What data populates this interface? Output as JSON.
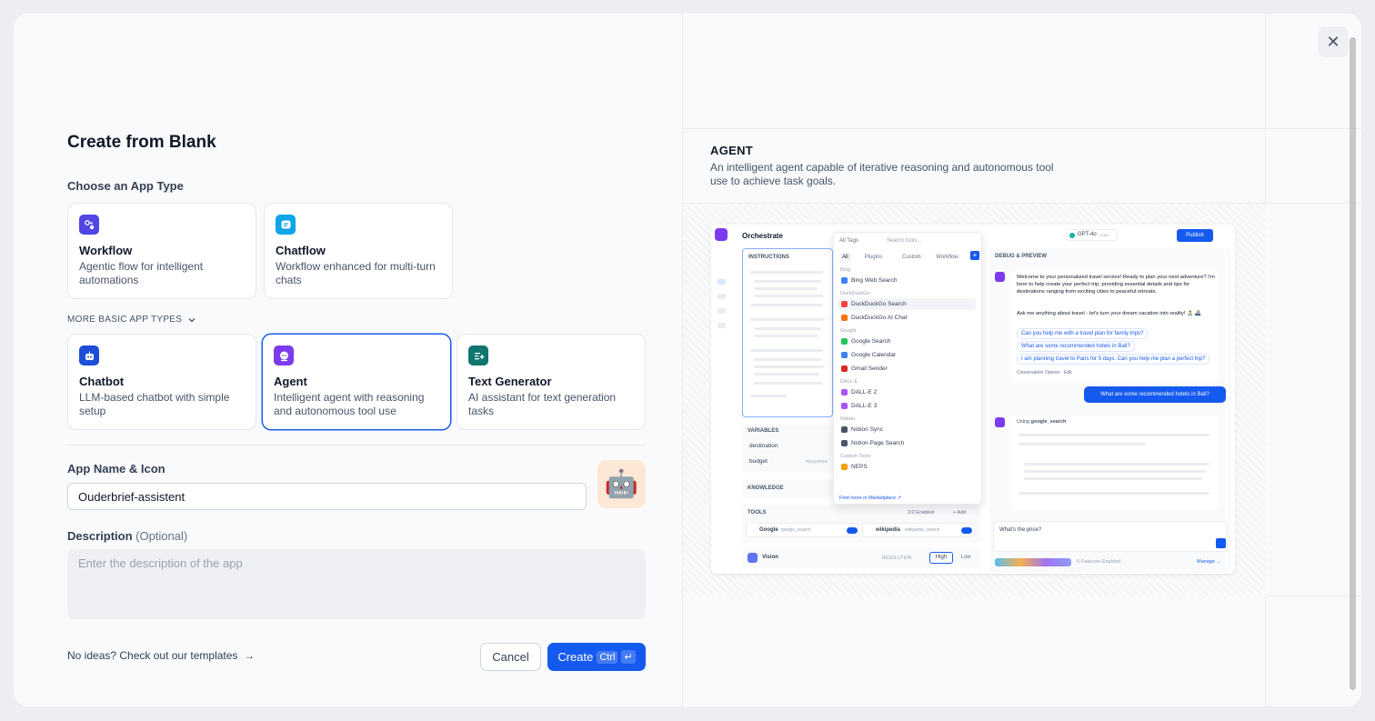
{
  "page": {
    "title": "Create from Blank",
    "choose_label": "Choose an App Type",
    "more_label": "MORE BASIC APP TYPES",
    "primary_types": [
      {
        "title": "Workflow",
        "desc": "Agentic flow for intelligent automations",
        "color": "#4f46e5"
      },
      {
        "title": "Chatflow",
        "desc": "Workflow enhanced for multi-turn chats",
        "color": "#0ea5e9"
      }
    ],
    "basic_types": [
      {
        "title": "Chatbot",
        "desc": "LLM-based chatbot with simple setup",
        "color": "#1d4ed8"
      },
      {
        "title": "Agent",
        "desc": "Intelligent agent with reasoning and autonomous tool use",
        "color": "#7c3aed"
      },
      {
        "title": "Text Generator",
        "desc": "AI assistant for text generation tasks",
        "color": "#0f766e"
      }
    ],
    "selected_type": "Agent",
    "name_label": "App Name & Icon",
    "name_value": "Ouderbrief-assistent",
    "avatar_emoji": "🤖",
    "desc_label": "Description",
    "desc_optional": "(Optional)",
    "desc_placeholder": "Enter the description of the app",
    "templates_link": "No ideas? Check out our templates",
    "cancel_label": "Cancel",
    "create_label": "Create",
    "create_kbd1": "Ctrl",
    "create_kbd2": "↵"
  },
  "preview": {
    "heading": "AGENT",
    "description": "An intelligent agent capable of iterative reasoning and autonomous tool use to achieve task goals.",
    "orchestrate": "Orchestrate",
    "instructions": "INSTRUCTIONS",
    "all_tags": "All Tags",
    "search_tools": "Search tools...",
    "tabs": [
      "All",
      "Plugins",
      "Custom",
      "Workflow"
    ],
    "tool_groups": [
      {
        "group": "Bing",
        "items": [
          "Bing Web Search"
        ]
      },
      {
        "group": "DuckDuckGo",
        "items": [
          "DuckDuckGo Search",
          "DuckDuckGo AI Chat"
        ]
      },
      {
        "group": "Google",
        "items": [
          "Google Search",
          "Google Calendar",
          "Gmail Sender"
        ]
      },
      {
        "group": "DALL-E",
        "items": [
          "DALL-E 2",
          "DALL-E 3"
        ]
      },
      {
        "group": "Notion",
        "items": [
          "Notion Sync",
          "Notion Page Search"
        ]
      },
      {
        "group": "Custom Tools",
        "items": [
          "NEPS"
        ]
      }
    ],
    "find_more": "Find more in Marketplace ↗",
    "variables": "VARIABLES",
    "var1": "destination",
    "var2": "budget",
    "required": "REQUIRED",
    "knowledge": "KNOWLEDGE",
    "tools": "TOOLS",
    "tools_enabled": "2/2 Enabled",
    "add": "+ Add",
    "tool1_name": "Google",
    "tool1_id": "google_search",
    "tool2_name": "wikipedia",
    "tool2_id": "wikipedia_search",
    "vision": "Vision",
    "resolution": "RESOLUTION",
    "high": "High",
    "low": "Low",
    "model": "GPT-4o",
    "model_tag": "CHAT",
    "publish": "Publish",
    "debug": "DEBUG & PREVIEW",
    "welcome": "Welcome to your personalized travel service! Ready to plan your next adventure? I'm here to help create your perfect trip, providing essential details and tips for destinations ranging from exciting cities to peaceful retreats.",
    "ask": "Ask me anything about travel - let's turn your dream vacation into reality! 🏝️ 🚢",
    "suggestions": [
      "Can you help me with a travel plan for family trips?",
      "What are some recommended hotels in Bali?",
      "I am planning travel to Paris for 5 days. Can you help me plan a perfect trip?"
    ],
    "opener": "Conversation Opener · Edit",
    "user_msg": "What are some recommended hotels in Bali?",
    "using": "Using",
    "using_tool": "google_search",
    "input_text": "What's the price?",
    "features": "6 Features Enabled",
    "manage": "Manage →"
  }
}
